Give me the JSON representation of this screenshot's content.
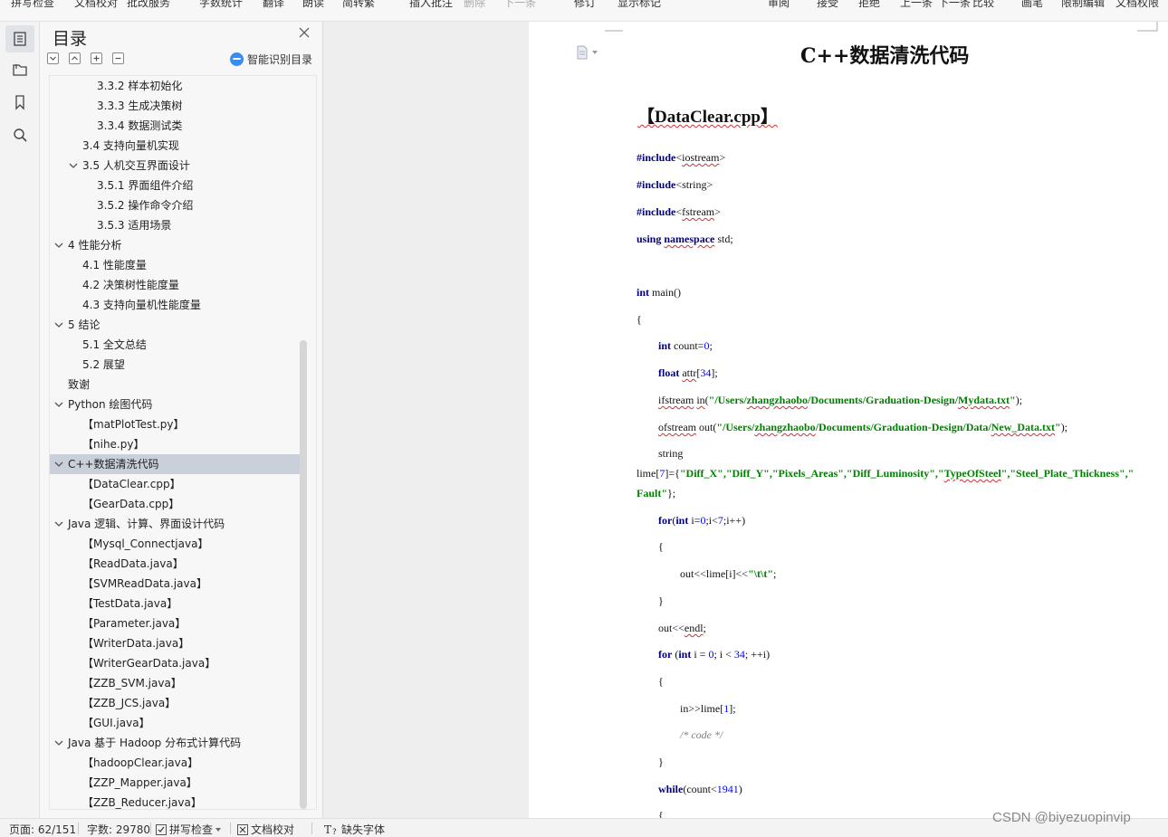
{
  "ribbon": {
    "items": [
      "拼写检查",
      "文档校对",
      "批改服务",
      "字数统计",
      "翻译",
      "朗读",
      "简转繁",
      "插入批注",
      "删除",
      "下一条",
      "修订",
      "显示标记",
      "审阅",
      "接受",
      "拒绝",
      "上一条",
      "下一条",
      "比较",
      "画笔",
      "限制编辑",
      "文档权限"
    ]
  },
  "rail": {
    "icons": [
      "toc-icon",
      "nav-pane-icon",
      "bookmark-icon",
      "search-icon"
    ]
  },
  "toc": {
    "title": "目录",
    "smart_toc_label": "智能识别目录",
    "items": [
      {
        "label": "3.3.2  样本初始化",
        "indent": 3,
        "caret": false
      },
      {
        "label": "3.3.3  生成决策树",
        "indent": 3,
        "caret": false
      },
      {
        "label": "3.3.4  数据测试类",
        "indent": 3,
        "caret": false
      },
      {
        "label": "3.4  支持向量机实现",
        "indent": 2,
        "caret": false
      },
      {
        "label": "3.5  人机交互界面设计",
        "indent": 2,
        "caret": true
      },
      {
        "label": "3.5.1  界面组件介绍",
        "indent": 3,
        "caret": false
      },
      {
        "label": "3.5.2  操作命令介绍",
        "indent": 3,
        "caret": false
      },
      {
        "label": "3.5.3  适用场景",
        "indent": 3,
        "caret": false
      },
      {
        "label": "4  性能分析",
        "indent": 1,
        "caret": true
      },
      {
        "label": "4.1  性能度量",
        "indent": 2,
        "caret": false
      },
      {
        "label": "4.2  决策树性能度量",
        "indent": 2,
        "caret": false
      },
      {
        "label": "4.3  支持向量机性能度量",
        "indent": 2,
        "caret": false
      },
      {
        "label": "5  结论",
        "indent": 1,
        "caret": true
      },
      {
        "label": "5.1  全文总结",
        "indent": 2,
        "caret": false
      },
      {
        "label": "5.2  展望",
        "indent": 2,
        "caret": false
      },
      {
        "label": "致谢",
        "indent": 1,
        "caret": false
      },
      {
        "label": "Python 绘图代码",
        "indent": 1,
        "caret": true
      },
      {
        "label": "【matPlotTest.py】",
        "indent": 2,
        "caret": false
      },
      {
        "label": "【nihe.py】",
        "indent": 2,
        "caret": false
      },
      {
        "label": "C++数据清洗代码",
        "indent": 1,
        "caret": true,
        "selected": true
      },
      {
        "label": "【DataClear.cpp】",
        "indent": 2,
        "caret": false
      },
      {
        "label": "【GearData.cpp】",
        "indent": 2,
        "caret": false
      },
      {
        "label": "Java  逻辑、计算、界面设计代码",
        "indent": 1,
        "caret": true
      },
      {
        "label": "【Mysql_Connectjava】",
        "indent": 2,
        "caret": false
      },
      {
        "label": "【ReadData.java】",
        "indent": 2,
        "caret": false
      },
      {
        "label": "【SVMReadData.java】",
        "indent": 2,
        "caret": false
      },
      {
        "label": "【TestData.java】",
        "indent": 2,
        "caret": false
      },
      {
        "label": "【Parameter.java】",
        "indent": 2,
        "caret": false
      },
      {
        "label": "【WriterData.java】",
        "indent": 2,
        "caret": false
      },
      {
        "label": "【WriterGearData.java】",
        "indent": 2,
        "caret": false
      },
      {
        "label": "【ZZB_SVM.java】",
        "indent": 2,
        "caret": false
      },
      {
        "label": "【ZZB_JCS.java】",
        "indent": 2,
        "caret": false
      },
      {
        "label": "【GUI.java】",
        "indent": 2,
        "caret": false
      },
      {
        "label": "Java  基于 Hadoop 分布式计算代码",
        "indent": 1,
        "caret": true
      },
      {
        "label": "【hadoopClear.java】",
        "indent": 2,
        "caret": false
      },
      {
        "label": "【ZZP_Mapper.java】",
        "indent": 2,
        "caret": false
      },
      {
        "label": "【ZZB_Reducer.java】",
        "indent": 2,
        "caret": false
      }
    ]
  },
  "document": {
    "title": "C++数据清洗代码",
    "heading": "【DataClear.cpp】",
    "code": [
      {
        "indent": 0,
        "parts": [
          [
            "kw",
            "#include"
          ],
          [
            "",
            "<"
          ],
          [
            "sq",
            "iostream"
          ],
          [
            "",
            ">"
          ]
        ]
      },
      {
        "indent": 0,
        "parts": [
          [
            "kw",
            "#include"
          ],
          [
            "",
            "<string>"
          ]
        ]
      },
      {
        "indent": 0,
        "parts": [
          [
            "kw",
            "#include"
          ],
          [
            "",
            "<"
          ],
          [
            "sq",
            "fstream"
          ],
          [
            "",
            ">"
          ]
        ]
      },
      {
        "indent": 0,
        "parts": [
          [
            "kw",
            "using "
          ],
          [
            "kw sq",
            "namespace"
          ],
          [
            "",
            " std;"
          ]
        ]
      },
      {
        "indent": 0,
        "parts": [
          [
            "kw",
            "int"
          ],
          [
            "",
            " main()"
          ]
        ]
      },
      {
        "indent": 0,
        "parts": [
          [
            "",
            "{"
          ]
        ]
      },
      {
        "indent": 1,
        "parts": [
          [
            "kw",
            "int"
          ],
          [
            "",
            " count="
          ],
          [
            "num",
            "0"
          ],
          [
            "",
            ";"
          ]
        ]
      },
      {
        "indent": 1,
        "parts": [
          [
            "kw",
            "float"
          ],
          [
            "",
            " "
          ],
          [
            "sq",
            "attr"
          ],
          [
            "",
            "["
          ],
          [
            "num",
            "34"
          ],
          [
            "",
            "];"
          ]
        ]
      },
      {
        "indent": 1,
        "parts": [
          [
            "sq",
            "ifstream"
          ],
          [
            "",
            " "
          ],
          [
            "sq",
            "in"
          ],
          [
            "",
            "("
          ],
          [
            "str",
            "\"/Users/"
          ],
          [
            "str sq",
            "zhangzhaobo"
          ],
          [
            "str",
            "/Documents/Graduation-Design/"
          ],
          [
            "str sq",
            "Mydata.txt"
          ],
          [
            "str",
            "\""
          ],
          [
            "",
            ");"
          ]
        ]
      },
      {
        "indent": 1,
        "parts": [
          [
            "sq",
            "ofstream"
          ],
          [
            "",
            " out("
          ],
          [
            "str",
            "\"/Users/"
          ],
          [
            "str sq",
            "zhangzhaobo"
          ],
          [
            "str",
            "/Documents/Graduation-Design/Data/"
          ],
          [
            "str sq",
            "New_Data.txt"
          ],
          [
            "str",
            "\""
          ],
          [
            "",
            ");"
          ]
        ]
      },
      {
        "indent": 1,
        "parts": [
          [
            "",
            "string"
          ]
        ]
      },
      {
        "indent": 0,
        "parts": [
          [
            "",
            "lime["
          ],
          [
            "num",
            "7"
          ],
          [
            "",
            "]={"
          ],
          [
            "str",
            "\"Diff_X\",\"Diff_Y\",\"Pixels_Areas\",\"Diff_Luminosity\",\""
          ],
          [
            "str sq",
            "TypeOfSteel"
          ],
          [
            "str",
            "\",\"Steel_Plate_Thickness\",\""
          ]
        ]
      },
      {
        "indent": 0,
        "parts": [
          [
            "str",
            "Fault\""
          ],
          [
            "",
            "};"
          ]
        ]
      },
      {
        "indent": 1,
        "parts": [
          [
            "kw",
            "for"
          ],
          [
            "",
            "("
          ],
          [
            "kw",
            "int"
          ],
          [
            "",
            " i="
          ],
          [
            "num",
            "0"
          ],
          [
            "",
            ";i<"
          ],
          [
            "num",
            "7"
          ],
          [
            "",
            ";i++)"
          ]
        ]
      },
      {
        "indent": 1,
        "parts": [
          [
            "",
            "{"
          ]
        ]
      },
      {
        "indent": 2,
        "parts": [
          [
            "",
            "out<<lime[i]<<"
          ],
          [
            "str",
            "\"\\t\\t\""
          ],
          [
            "",
            ";"
          ]
        ]
      },
      {
        "indent": 1,
        "parts": [
          [
            "",
            "}"
          ]
        ]
      },
      {
        "indent": 1,
        "parts": [
          [
            "",
            "out<<"
          ],
          [
            "sq",
            "endl"
          ],
          [
            "",
            ";"
          ]
        ]
      },
      {
        "indent": 1,
        "parts": [
          [
            "kw",
            "for"
          ],
          [
            "",
            " ("
          ],
          [
            "kw",
            "int"
          ],
          [
            "",
            " i = "
          ],
          [
            "num",
            "0"
          ],
          [
            "",
            "; i < "
          ],
          [
            "num",
            "34"
          ],
          [
            "",
            "; ++i)"
          ]
        ]
      },
      {
        "indent": 1,
        "parts": [
          [
            "",
            "{"
          ]
        ]
      },
      {
        "indent": 2,
        "parts": [
          [
            "",
            "in>>lime["
          ],
          [
            "num",
            "1"
          ],
          [
            "",
            "];"
          ]
        ]
      },
      {
        "indent": 2,
        "parts": [
          [
            "cmt",
            "/* code */"
          ]
        ]
      },
      {
        "indent": 1,
        "parts": [
          [
            "",
            "}"
          ]
        ]
      },
      {
        "indent": 1,
        "parts": [
          [
            "kw",
            "while"
          ],
          [
            "",
            "(count<"
          ],
          [
            "num",
            "1941"
          ],
          [
            "",
            ")"
          ]
        ]
      },
      {
        "indent": 1,
        "parts": [
          [
            "",
            "{"
          ]
        ]
      }
    ]
  },
  "status": {
    "page": "页面: 62/151",
    "words": "字数: 29780",
    "spellcheck": "拼写检查",
    "proofread": "文档校对",
    "missing_fonts": "缺失字体"
  },
  "watermark": "CSDN @biyezuopinvip"
}
